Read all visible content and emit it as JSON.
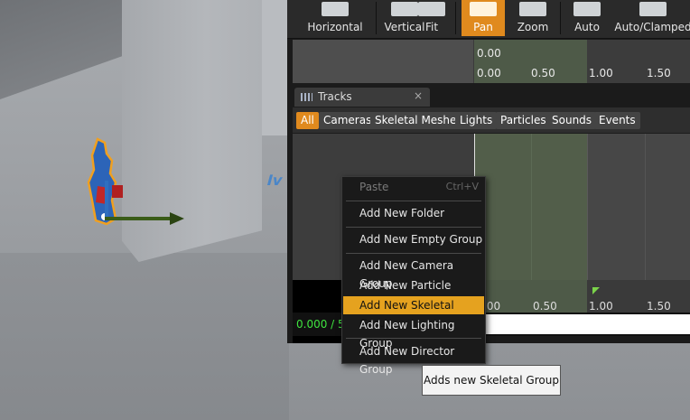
{
  "toolbar": {
    "buttons": [
      {
        "label": "Horizontal",
        "icon": "horizontal-fit-icon"
      },
      {
        "label": "Vertical",
        "icon": "vertical-fit-icon"
      },
      {
        "label": "Fit",
        "icon": "fit-icon"
      },
      {
        "label": "Pan",
        "icon": "pan-icon",
        "active": true
      },
      {
        "label": "Zoom",
        "icon": "zoom-icon"
      },
      {
        "label": "Auto",
        "icon": "auto-tangent-icon"
      },
      {
        "label": "Auto/Clamped",
        "icon": "auto-clamped-icon"
      }
    ]
  },
  "curve_header": {
    "top_value": "0.00",
    "ticks": [
      "0.00",
      "0.50",
      "1.00",
      "1.50"
    ]
  },
  "tab": {
    "title": "Tracks",
    "close": "×"
  },
  "filters": [
    "All",
    "Cameras",
    "Skeletal Meshes",
    "Lights",
    "Particles",
    "Sounds",
    "Events"
  ],
  "timeline": {
    "ticks": [
      ".00",
      "0.50",
      "1.00",
      "1.50"
    ],
    "time_readout": "0.000 / 5"
  },
  "context_menu": {
    "paste": {
      "label": "Paste",
      "shortcut": "Ctrl+V"
    },
    "items": [
      "Add New Folder",
      "Add New Empty Group",
      "Add New Camera Group",
      "Add New Particle Group",
      "Add New Skeletal Group",
      "Add New Lighting Group",
      "Add New Director Group"
    ]
  },
  "tooltip": "Adds new Skeletal Group",
  "colors": {
    "accent": "#e08a1e",
    "menu_highlight": "#e5a21f",
    "time_green": "#3fe33f"
  }
}
